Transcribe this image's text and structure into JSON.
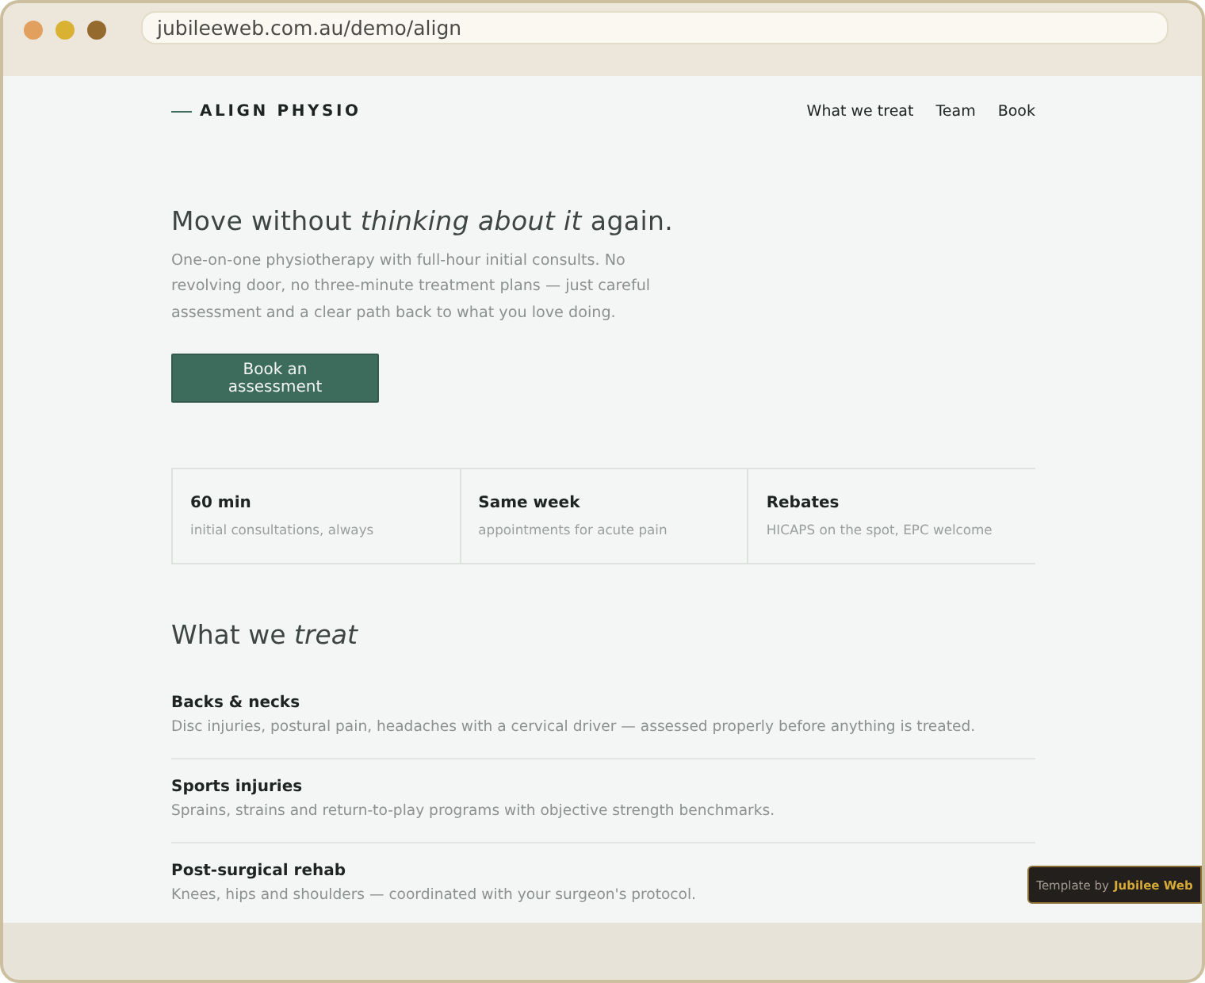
{
  "browser": {
    "url": "jubileeweb.com.au/demo/align"
  },
  "header": {
    "logo": "ALIGN PHYSIO",
    "nav": [
      {
        "label": "What we treat"
      },
      {
        "label": "Team"
      },
      {
        "label": "Book"
      }
    ]
  },
  "hero": {
    "heading": "Move without *thinking about it* again.",
    "text": "One-on-one physiotherapy with full-hour initial consults. No revolving door, no three-minute treatment plans — just careful assessment and a clear path back to what you love doing.",
    "button": "Book an assessment"
  },
  "stats": [
    {
      "value": "60 min",
      "caption": "initial consultations, always"
    },
    {
      "value": "Same week",
      "caption": "appointments for acute pain"
    },
    {
      "value": "Rebates",
      "caption": "HICAPS on the spot, EPC welcome"
    }
  ],
  "treat": {
    "heading": "What we *treat*",
    "items": [
      {
        "title": "Backs & necks",
        "text": "Disc injuries, postural pain, headaches with a cervical driver — assessed properly before anything is treated."
      },
      {
        "title": "Sports injuries",
        "text": "Sprains, strains and return-to-play programs with objective strength benchmarks."
      },
      {
        "title": "Post-surgical rehab",
        "text": "Knees, hips and shoulders — coordinated with your surgeon's protocol."
      }
    ]
  },
  "badge": {
    "prefix": "Template by",
    "brand": "Jubilee Web"
  }
}
